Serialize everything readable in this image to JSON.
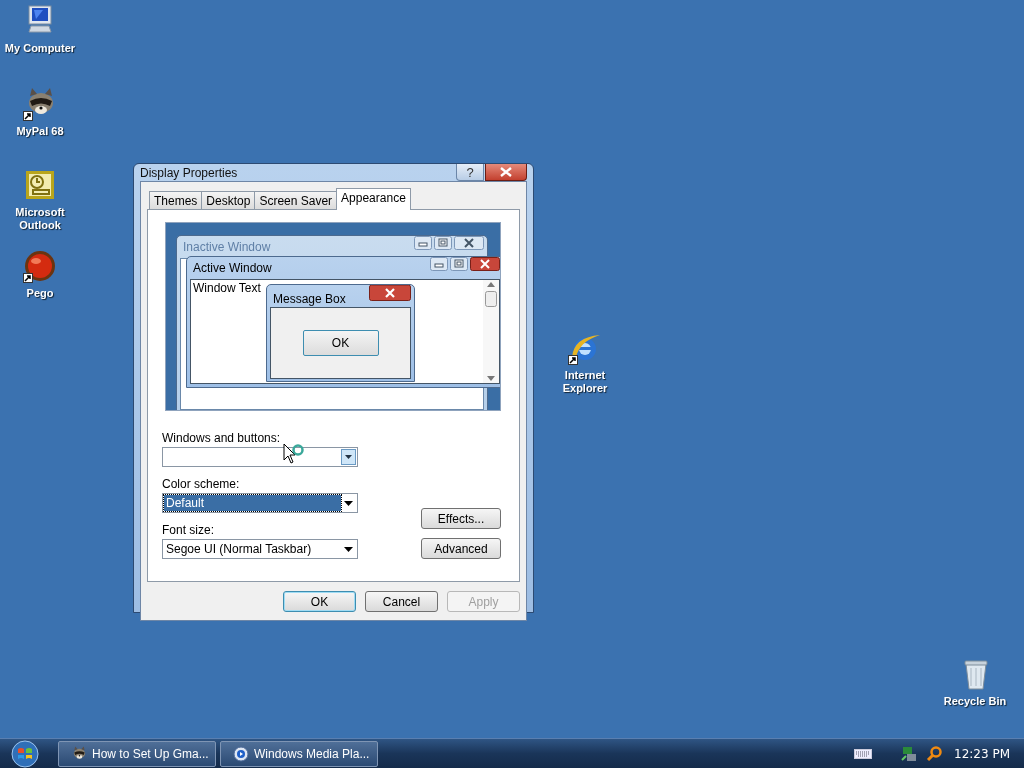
{
  "desktop_icons": [
    {
      "label": "My Computer",
      "kind": "computer",
      "shortcut": false
    },
    {
      "label": "MyPal 68",
      "kind": "raccoon",
      "shortcut": true
    },
    {
      "label": "Microsoft Outlook",
      "kind": "outlook",
      "shortcut": false
    },
    {
      "label": "Pego",
      "kind": "pego",
      "shortcut": true
    },
    {
      "label": "Internet Explorer",
      "kind": "ie",
      "shortcut": true
    },
    {
      "label": "Recycle Bin",
      "kind": "recycle",
      "shortcut": false
    }
  ],
  "dialog": {
    "title": "Display Properties",
    "help_button": "?",
    "tabs": [
      {
        "label": "Themes",
        "selected": false
      },
      {
        "label": "Desktop",
        "selected": false
      },
      {
        "label": "Screen Saver",
        "selected": false
      },
      {
        "label": "Appearance",
        "selected": true
      }
    ],
    "preview": {
      "inactive_title": "Inactive Window",
      "active_title": "Active Window",
      "window_text": "Window Text",
      "message_box_title": "Message Box",
      "message_box_button": "OK"
    },
    "fields": [
      {
        "label": "Windows and buttons:",
        "highlighted": false
      },
      {
        "label": "Color scheme:",
        "value": "Default",
        "highlighted": true
      },
      {
        "label": "Font size:",
        "value": "Segoe UI (Normal Taskbar)",
        "highlighted": false
      }
    ],
    "side_buttons": [
      "Effects...",
      "Advanced"
    ],
    "buttons": [
      {
        "label": "OK",
        "default": true,
        "disabled": false
      },
      {
        "label": "Cancel",
        "default": false,
        "disabled": false
      },
      {
        "label": "Apply",
        "default": false,
        "disabled": true
      }
    ]
  },
  "taskbar": {
    "tasks": [
      {
        "label": "How to Set Up Gma...",
        "kind": "raccoon"
      },
      {
        "label": "Windows Media Pla...",
        "kind": "media"
      }
    ],
    "clock": "12:23 PM"
  }
}
